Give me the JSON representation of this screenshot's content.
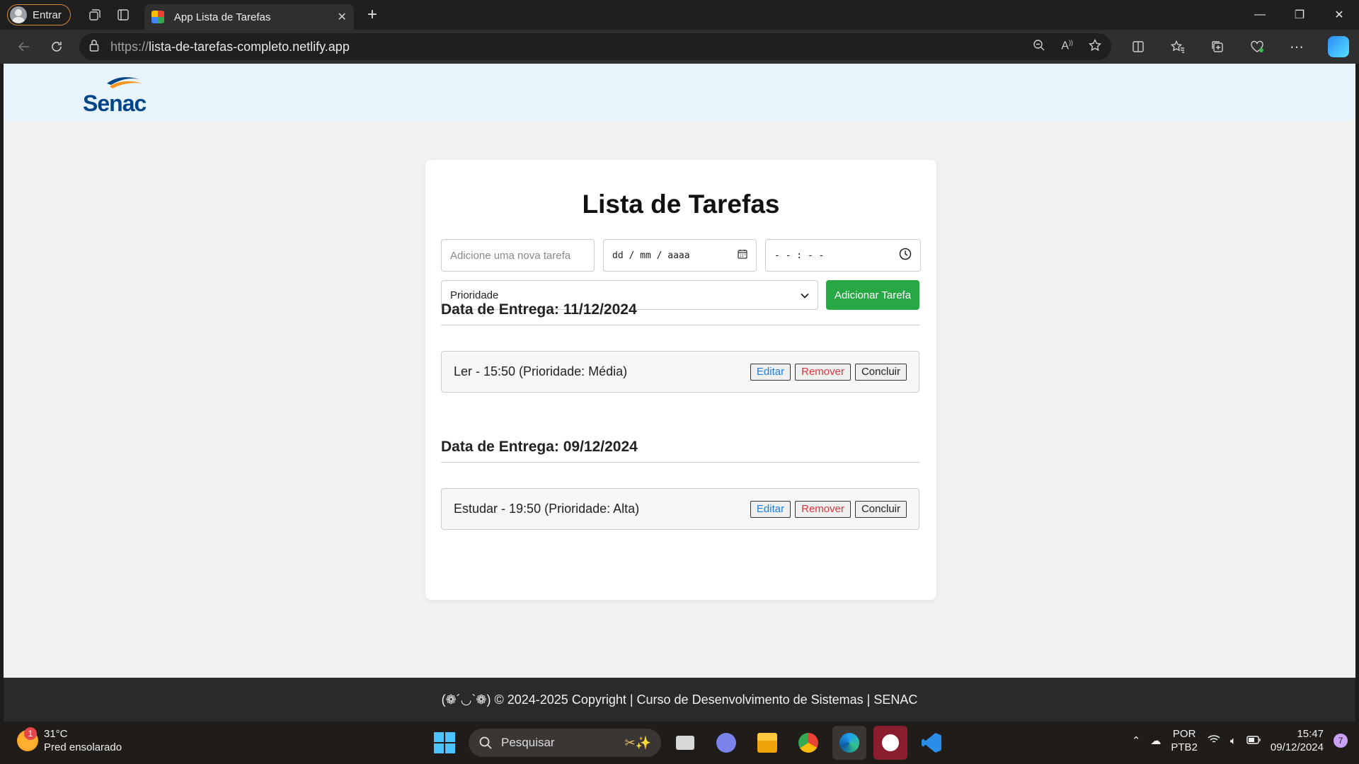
{
  "browser": {
    "profile_label": "Entrar",
    "tab_title": "App Lista de Tarefas",
    "url_protocol": "https://",
    "url_host": "lista-de-tarefas-completo.netlify.app"
  },
  "header": {
    "logo_text": "Senac"
  },
  "todo": {
    "title": "Lista de Tarefas",
    "task_placeholder": "Adicione uma nova tarefa",
    "date_placeholder": "dd / mm / aaaa",
    "time_placeholder": "- - : - -",
    "priority_selected": "Prioridade",
    "add_button": "Adicionar Tarefa",
    "groups": [
      {
        "heading": "Data de Entrega: 11/12/2024",
        "tasks": [
          {
            "text": "Ler - 15:50 (Prioridade: Média)",
            "edit": "Editar",
            "remove": "Remover",
            "done": "Concluir"
          }
        ]
      },
      {
        "heading": "Data de Entrega: 09/12/2024",
        "tasks": [
          {
            "text": "Estudar - 19:50 (Prioridade: Alta)",
            "edit": "Editar",
            "remove": "Remover",
            "done": "Concluir"
          }
        ]
      }
    ]
  },
  "footer": {
    "text": "(❁´◡`❁) © 2024-2025 Copyright | Curso de Desenvolvimento de Sistemas | SENAC"
  },
  "taskbar": {
    "weather_temp": "31°C",
    "weather_desc": "Pred ensolarado",
    "weather_badge": "1",
    "search_label": "Pesquisar",
    "lang_1": "POR",
    "lang_2": "PTB2",
    "time": "15:47",
    "date": "09/12/2024",
    "notifications": "7"
  },
  "colors": {
    "accent_green": "#28a745",
    "edit_blue": "#1e7ed6",
    "remove_red": "#d9363e",
    "header_bg": "#e8f4fc",
    "footer_bg": "#2a2a2a"
  }
}
